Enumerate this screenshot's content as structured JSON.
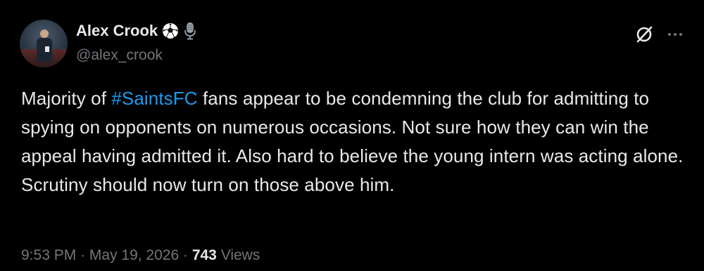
{
  "author": {
    "name": "Alex Crook",
    "handle": "@alex_crook",
    "badges": [
      "soccer-ball-icon",
      "microphone-icon"
    ]
  },
  "tweet": {
    "text_before": "Majority of ",
    "hashtag": "#SaintsFC",
    "text_after": " fans appear to be condemning the club for admitting to spying on opponents on numerous occasions. Not sure how they can win the appeal having admitted it. Also hard to believe the young intern was acting alone. Scrutiny should now turn on those above him."
  },
  "meta": {
    "time": "9:53 PM",
    "sep1": " · ",
    "date": "May 19, 2026",
    "sep2": " · ",
    "views_count": "743",
    "views_label": " Views"
  },
  "colors": {
    "background": "#000000",
    "text": "#e7e9ea",
    "secondary": "#71767b",
    "link": "#1d9bf0"
  },
  "icons": [
    "grok-icon",
    "more-icon"
  ]
}
